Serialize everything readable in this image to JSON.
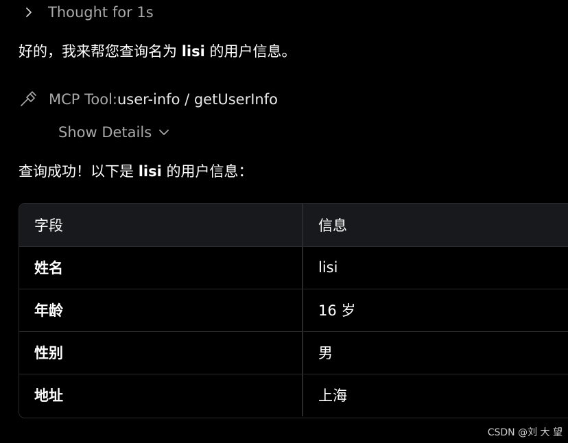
{
  "thought": {
    "label": "Thought for 1s"
  },
  "intro": {
    "before": "好的，我来帮您查询名为 ",
    "username": "lisi",
    "after": " 的用户信息。"
  },
  "tool": {
    "prefix": "MCP Tool: ",
    "name": "user-info / getUserInfo",
    "details_label": "Show Details"
  },
  "result": {
    "before": "查询成功！以下是 ",
    "username": "lisi",
    "after": " 的用户信息："
  },
  "table": {
    "headers": [
      "字段",
      "信息"
    ],
    "rows": [
      {
        "field": "姓名",
        "value": "lisi"
      },
      {
        "field": "年龄",
        "value": "16 岁"
      },
      {
        "field": "性别",
        "value": "男"
      },
      {
        "field": "地址",
        "value": "上海"
      }
    ]
  },
  "watermark": "CSDN @刘 大 望"
}
